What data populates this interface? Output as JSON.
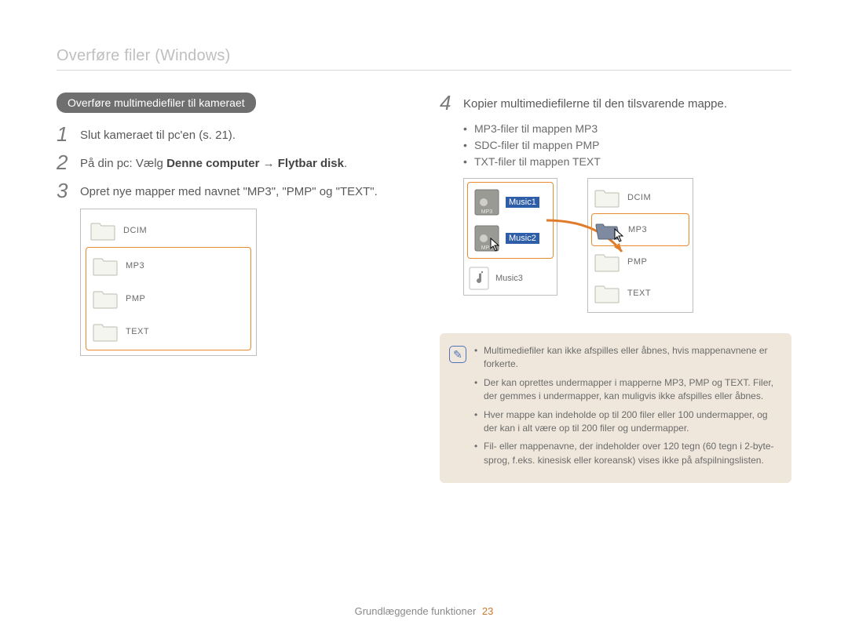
{
  "page": {
    "title": "Overføre filer (Windows)",
    "footer_text": "Grundlæggende funktioner",
    "page_number": "23"
  },
  "section_pill": "Overføre multimediefiler til kameraet",
  "steps": {
    "s1": {
      "num": "1",
      "text": "Slut kameraet til pc'en (s. 21)."
    },
    "s2": {
      "num": "2",
      "prefix": "På din pc: Vælg ",
      "bold1": "Denne computer",
      "arrow": " → ",
      "bold2": "Flytbar disk",
      "suffix": "."
    },
    "s3": {
      "num": "3",
      "text": "Opret nye mapper med navnet \"MP3\", \"PMP\" og \"TEXT\"."
    },
    "s4": {
      "num": "4",
      "text": "Kopier multimediefilerne til den tilsvarende mappe."
    }
  },
  "sublist": [
    "MP3-filer til mappen MP3",
    "SDC-filer til mappen PMP",
    "TXT-filer til mappen TEXT"
  ],
  "left_folders": [
    "DCIM",
    "MP3",
    "PMP",
    "TEXT"
  ],
  "src_items": [
    "Music1",
    "Music2",
    "Music3"
  ],
  "dest_folders": [
    "DCIM",
    "MP3",
    "PMP",
    "TEXT"
  ],
  "note_icon_glyph": "✎",
  "notes": [
    "Multimediefiler kan ikke afspilles eller åbnes, hvis mappenavnene er forkerte.",
    "Der kan oprettes undermapper i mapperne MP3, PMP og TEXT. Filer, der gemmes i undermapper, kan muligvis ikke afspilles eller åbnes.",
    "Hver mappe kan indeholde op til 200 filer eller 100 undermapper, og der kan i alt være op til 200 filer og undermapper.",
    "Fil- eller mappenavne, der indeholder over 120 tegn (60 tegn i 2-byte-sprog, f.eks. kinesisk eller koreansk) vises ikke på afspilningslisten."
  ]
}
